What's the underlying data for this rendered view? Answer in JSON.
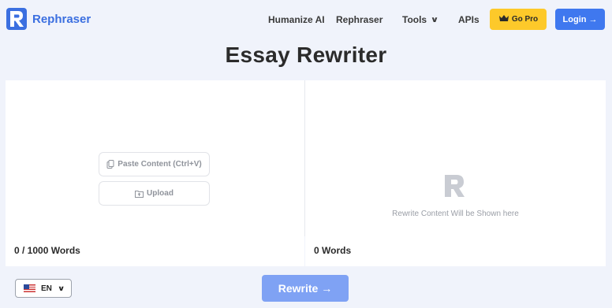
{
  "brand": {
    "name": "Rephraser",
    "color": "#3b6fe0"
  },
  "nav": {
    "humanize": "Humanize AI",
    "rephraser": "Rephraser",
    "tools": "Tools",
    "apis": "APIs",
    "go_pro": "Go Pro",
    "login": "Login"
  },
  "page": {
    "title": "Essay Rewriter"
  },
  "input_panel": {
    "paste_label": "Paste Content (Ctrl+V)",
    "upload_label": "Upload",
    "word_count": "0 / 1000 Words"
  },
  "output_panel": {
    "placeholder": "Rewrite Content Will be Shown here",
    "word_count": "0 Words"
  },
  "footer": {
    "language": "EN",
    "rewrite_label": "Rewrite"
  },
  "colors": {
    "background": "#f0f3fb",
    "pro_button": "#fdc92a",
    "login_button": "#3f78ef",
    "rewrite_button": "#7fa2f4"
  }
}
